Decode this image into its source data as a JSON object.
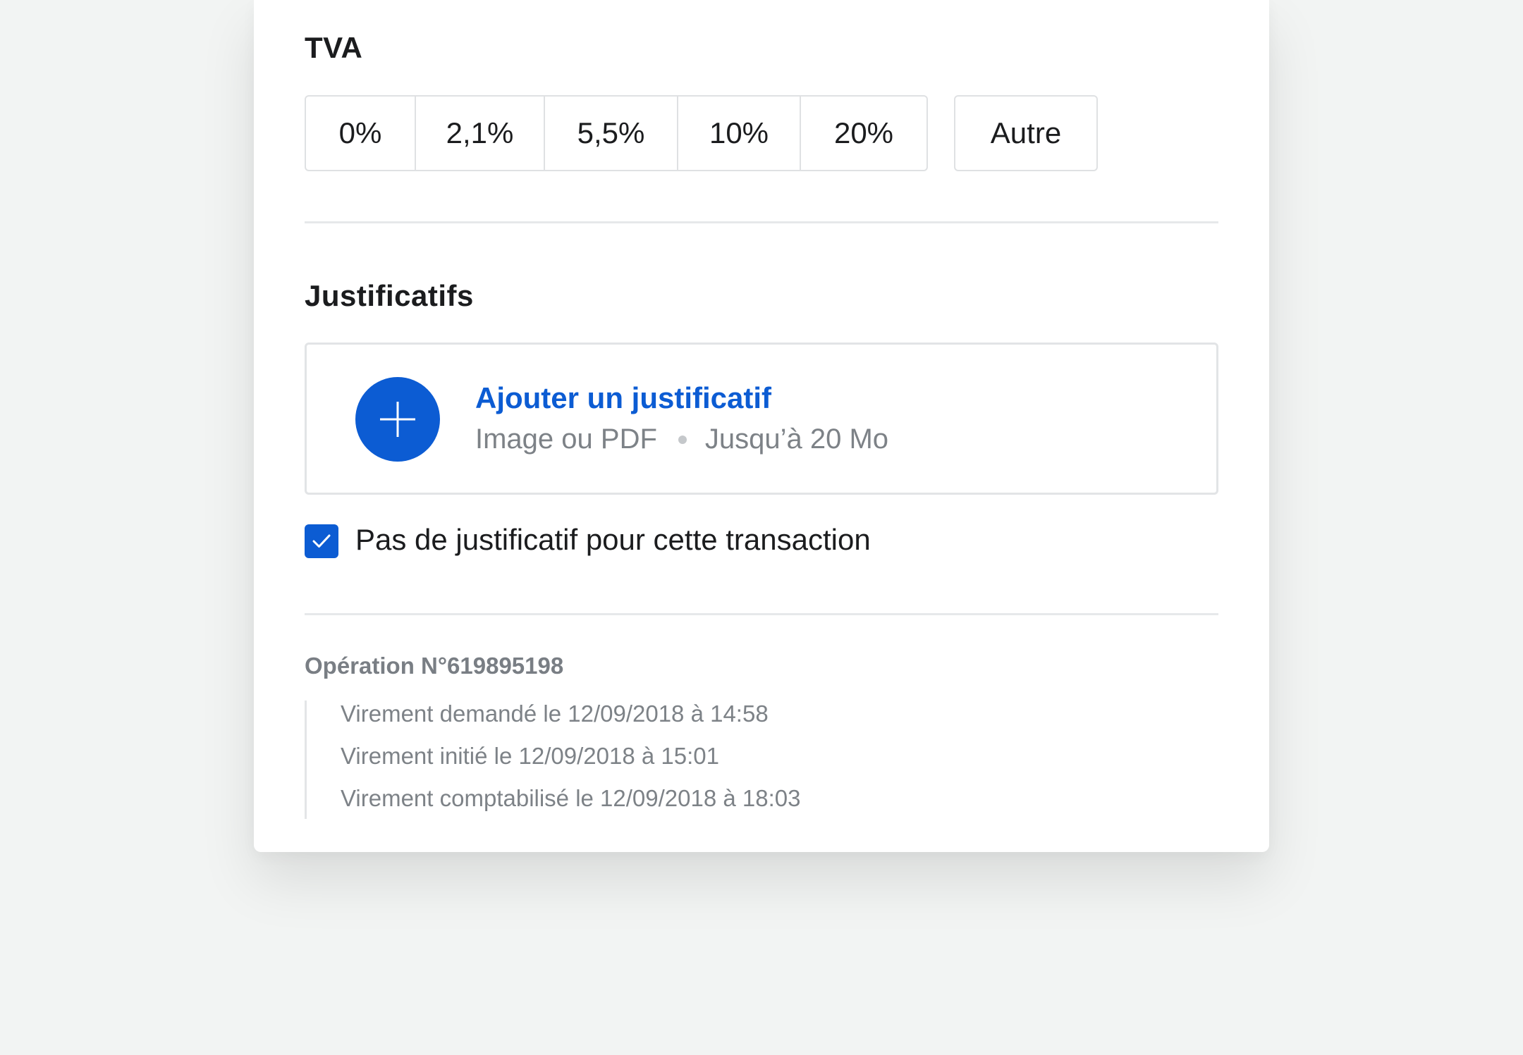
{
  "vat": {
    "title": "TVA",
    "options": [
      "0%",
      "2,1%",
      "5,5%",
      "10%",
      "20%"
    ],
    "other_label": "Autre"
  },
  "attachments": {
    "title": "Justificatifs",
    "upload_title": "Ajouter un justificatif",
    "upload_formats": "Image ou PDF",
    "upload_limit": "Jusqu’à 20 Mo",
    "upload_icon": "plus-icon",
    "no_attachment_label": "Pas de justificatif pour cette transaction",
    "no_attachment_checked": true
  },
  "operation": {
    "number_label": "Opération N°619895198",
    "history": [
      "Virement demandé le 12/09/2018 à 14:58",
      "Virement initié le 12/09/2018 à 15:01",
      "Virement comptabilisé le 12/09/2018 à 18:03"
    ]
  },
  "colors": {
    "accent": "#0c5cd3",
    "background": "#f2f4f3",
    "muted_text": "#7d8287"
  }
}
